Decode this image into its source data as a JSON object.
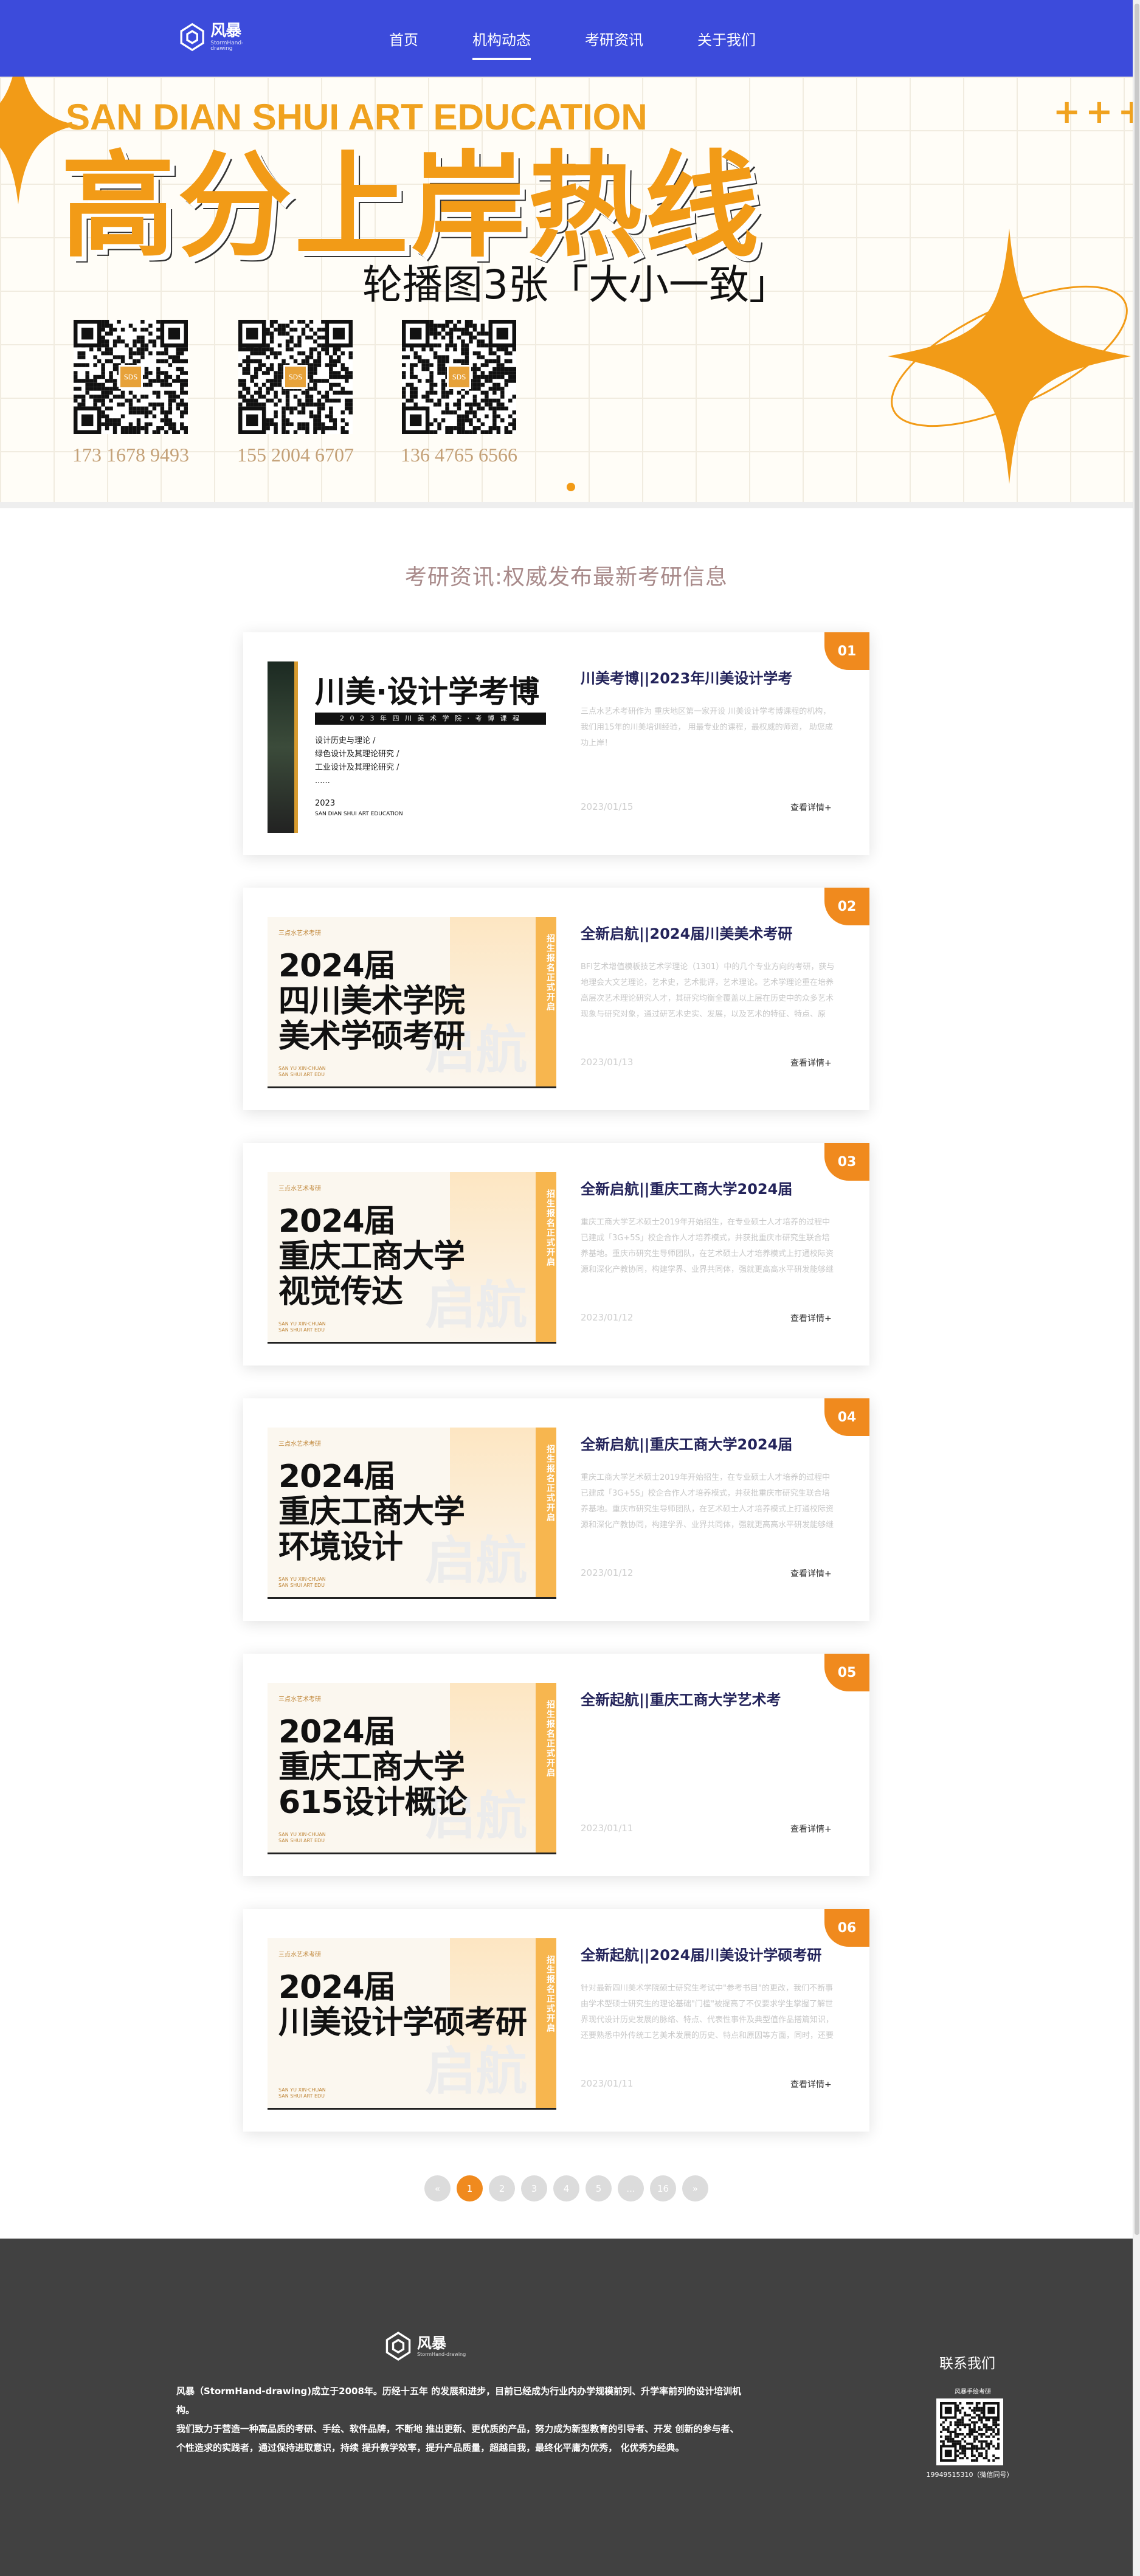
{
  "header": {
    "logo": {
      "cn": "风暴",
      "en": "StormHand-drawing"
    },
    "nav": [
      {
        "label": "首页",
        "active": false
      },
      {
        "label": "机构动态",
        "active": true
      },
      {
        "label": "考研资讯",
        "active": false
      },
      {
        "label": "关于我们",
        "active": false
      }
    ]
  },
  "banner": {
    "en_title": "SAN DIAN SHUI ART EDUCATION",
    "plus_marks": "+++",
    "cn_title": "高分上岸热线",
    "subtitle": "轮播图3张「大小一致」",
    "qr_badge": "SDS",
    "phones": [
      "173 1678 9493",
      "155 2004 6707",
      "136 4765 6566"
    ],
    "colors": {
      "accent": "#f29b17",
      "grid": "#f1ece0"
    }
  },
  "section": {
    "title": "考研资讯:权威发布最新考研信息"
  },
  "cards": [
    {
      "num": "01",
      "title": "川美考博||2023年川美设计学考",
      "desc": "三点水艺术考研作为 重庆地区第一家开设 川美设计学考博课程的机构， 我们用15年的川美培训经验， 用最专业的课程，最权威的师资， 助您成功上岸！",
      "date": "2023/01/15",
      "more": "查看详情+",
      "thumb": {
        "kind": "first",
        "big": "川美·设计学考博",
        "line": "2 0 2 3 年 四 川 美 术 学 院 · 考 博 课 程",
        "list": "设计历史与理论 /\n绿色设计及其理论研究 /\n工业设计及其理论研究 /\n......",
        "year": "2023",
        "edu": "SAN DIAN SHUI ART EDUCATION"
      }
    },
    {
      "num": "02",
      "title": "全新启航||2024届川美美术考研",
      "desc": "BFI艺术增值模板技艺术学理论（1301）中的几个专业方向的考研，获与地理会大文艺理论，艺术史，艺术批评，艺术理论。艺术学理论重在培养高层次艺术理论研究人才，其研究均衡全覆盖以上层在历史中的众多艺术现象与研究对象，通过研艺术史实、发展，以及艺术的特征、特点、原理、规律、以及各种作用等",
      "date": "2023/01/13",
      "more": "查看详情+",
      "thumb": {
        "kind": "poster",
        "brand": "三点水艺术考研",
        "title": "2024届\n四川美术学院\n美术学硕考研",
        "vbar": "招生报名正式开启",
        "ghost": "启航",
        "foot": "SAN YU XIN·CHUAN\nSAN SHUI ART EDU"
      }
    },
    {
      "num": "03",
      "title": "全新启航||重庆工商大学2024届",
      "desc": "重庆工商大学艺术硕士2019年开始招生，在专业硕士人才培养的过程中已建成「3G+5S」校企合作人才培养模式，并获批重庆市研究生联合培养基地。重庆市研究生导师团队，在艺术硕士人才培养模式上打通校际资源和深化产教协同，构建学界、业界共同体，强就更高高水平研发能够继承，一路行业企业角色实践……",
      "date": "2023/01/12",
      "more": "查看详情+",
      "thumb": {
        "kind": "poster",
        "brand": "三点水艺术考研",
        "title": "2024届\n重庆工商大学\n视觉传达",
        "vbar": "招生报名正式开启",
        "ghost": "启航",
        "foot": "SAN YU XIN·CHUAN\nSAN SHUI ART EDU"
      }
    },
    {
      "num": "04",
      "title": "全新启航||重庆工商大学2024届",
      "desc": "重庆工商大学艺术硕士2019年开始招生，在专业硕士人才培养的过程中已建成「3G+5S」校企合作人才培养模式，并获批重庆市研究生联合培养基地。重庆市研究生导师团队，在艺术硕士人才培养模式上打通校际资源和深化产教协同，构建学界、业界共同体，强就更高高水平研发能够继承，一路行业企业角色实践……",
      "date": "2023/01/12",
      "more": "查看详情+",
      "thumb": {
        "kind": "poster",
        "brand": "三点水艺术考研",
        "title": "2024届\n重庆工商大学\n环境设计",
        "vbar": "招生报名正式开启",
        "ghost": "启航",
        "foot": "SAN YU XIN·CHUAN\nSAN SHUI ART EDU"
      }
    },
    {
      "num": "05",
      "title": "全新起航||重庆工商大学艺术考",
      "desc": "",
      "date": "2023/01/11",
      "more": "查看详情+",
      "thumb": {
        "kind": "poster",
        "brand": "三点水艺术考研",
        "title": "2024届\n重庆工商大学\n615设计概论",
        "vbar": "招生报名正式开启",
        "ghost": "启航",
        "foot": "SAN YU XIN·CHUAN\nSAN SHUI ART EDU"
      }
    },
    {
      "num": "06",
      "title": "全新起航||2024届川美设计学硕考研",
      "desc": "针对最新四川美术学院硕士研究生考试中\"参考书目\"的更改，我们不断事由学术型硕士研究生的理论基础\"门槛\"被提高了不仅要求学生掌握了解世界现代设计历史发展的脉络、特点、代表性事件及典型值作品搭篇知识，还要熟悉中外传统工艺美术发展的历史、特点和原因等方面，同时，还要求学生掌握……",
      "date": "2023/01/11",
      "more": "查看详情+",
      "thumb": {
        "kind": "poster",
        "brand": "三点水艺术考研",
        "title": "2024届\n川美设计学硕考研",
        "vbar": "招生报名正式开启",
        "ghost": "启航",
        "foot": "SAN YU XIN·CHUAN\nSAN SHUI ART EDU"
      }
    }
  ],
  "pagination": {
    "prev": "«",
    "pages": [
      "1",
      "2",
      "3",
      "4",
      "5",
      "...",
      "16"
    ],
    "active": "1",
    "next": "»"
  },
  "footer": {
    "logo": {
      "cn": "风暴",
      "en": "StormHand-drawing"
    },
    "about": [
      "风暴（StormHand-drawing)成立于2008年。历经十五年 的发展和进步，目前已经成为行业内办学规模前列、升学率前列的设计培训机构。",
      "我们致力于营造一种高品质的考研、手绘、软件品牌，不断地 推出更新、更优质的产品，努力成为新型教育的引导者、开发 创新的参与者、个性造求的实践者，通过保持进取意识，持续 提升教学效率，提升产品质量，超越自我，最终化平庸为优秀， 化优秀为经典。"
    ],
    "contact_title": "联系我们",
    "qr_label": "风暴手绘考研",
    "wechat_id": "19949515310（微信同号）"
  }
}
